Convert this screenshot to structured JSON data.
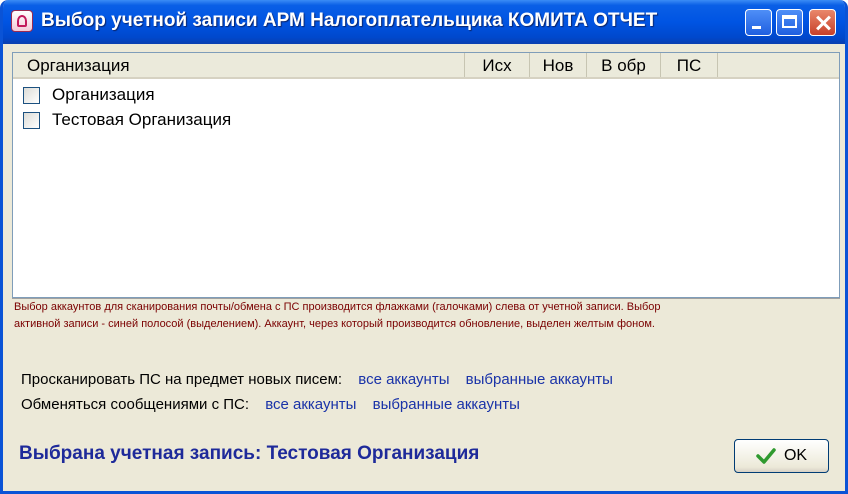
{
  "window": {
    "title": "Выбор учетной записи АРМ Налогоплательщика КОМИТА ОТЧЕТ"
  },
  "list": {
    "columns": [
      "Организация",
      "Исх",
      "Нов",
      "В обр",
      "ПС"
    ],
    "rows": [
      {
        "label": "Организация",
        "checked": false
      },
      {
        "label": "Тестовая Организация",
        "checked": false
      }
    ]
  },
  "note": {
    "line1": "Выбор аккаунтов для сканирования почты/обмена с ПС производится флажками (галочками) слева от учетной записи. Выбор",
    "line2": "активной записи - синей полосой (выделением). Аккаунт, через который производится обновление, выделен желтым фоном."
  },
  "scan": {
    "label": "Просканировать ПС на предмет новых писем:",
    "all_link": "все аккаунты",
    "selected_link": "выбранные аккаунты"
  },
  "exchange": {
    "label": "Обменяться сообщениями с ПС:",
    "all_link": "все аккаунты",
    "selected_link": "выбранные аккаунты"
  },
  "status": {
    "selected": "Выбрана учетная запись: Тестовая Организация"
  },
  "buttons": {
    "ok": "OK"
  },
  "icons": [
    "app-icon",
    "minimize-icon",
    "maximize-icon",
    "close-icon",
    "checkmark-icon"
  ],
  "colors": {
    "title_bar": "#0054e3",
    "link": "#1a33a8",
    "note": "#7a0000",
    "selected_text": "#1e2a9a"
  }
}
